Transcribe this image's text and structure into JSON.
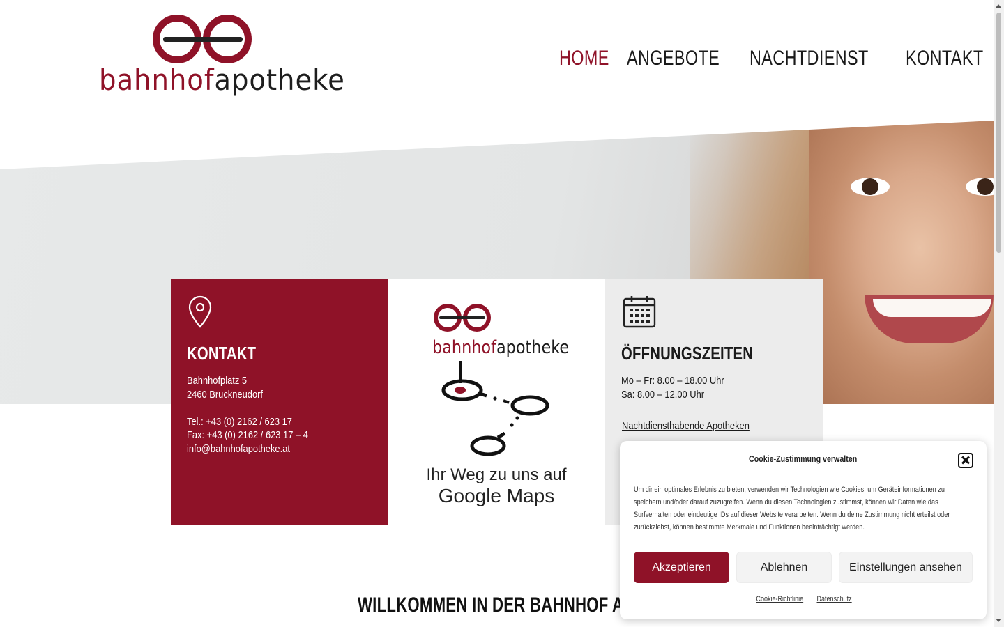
{
  "brand": {
    "logo_part1": "bahnhof",
    "logo_part2": "apotheke",
    "color_primary": "#8f1228",
    "color_dark": "#1e1e1e"
  },
  "nav": [
    {
      "label": "HOME",
      "active": true
    },
    {
      "label": "ANGEBOTE",
      "active": false
    },
    {
      "label": "NACHTDIENST",
      "active": false
    },
    {
      "label": "KONTAKT",
      "active": false
    }
  ],
  "contact_box": {
    "icon": "location-pin-icon",
    "title": "KONTAKT",
    "lines": [
      "Bahnhofplatz 5",
      "2460 Bruckneudorf",
      "",
      "Tel.: +43 (0) 2162 / 623 17",
      "Fax: +43 (0) 2162 / 623 17 – 4",
      "info@bahnhofapotheke.at"
    ]
  },
  "map_box": {
    "logo_part1": "bahnhof",
    "logo_part2": "apotheke",
    "caption_line1": "Ihr Weg zu uns auf",
    "caption_line2": "Google Maps"
  },
  "hours_box": {
    "icon": "calendar-icon",
    "title": "ÖFFNUNGSZEITEN",
    "lines": [
      "Mo – Fr: 8.00 – 18.00 Uhr",
      "Sa: 8.00 – 12.00 Uhr"
    ],
    "link": "Nachtdiensthabende Apotheken"
  },
  "welcome_heading": "WILLKOMMEN IN DER BAHNHOF APOTHEK",
  "cookie": {
    "title": "Cookie-Zustimmung verwalten",
    "text": "Um dir ein optimales Erlebnis zu bieten, verwenden wir Technologien wie Cookies, um Geräteinformationen zu speichern und/oder darauf zuzugreifen. Wenn du diesen Technologien zustimmst, können wir Daten wie das Surfverhalten oder eindeutige IDs auf dieser Website verarbeiten. Wenn du deine Zustimmung nicht erteilst oder zurückziehst, können bestimmte Merkmale und Funktionen beeinträchtigt werden.",
    "accept": "Akzeptieren",
    "deny": "Ablehnen",
    "settings": "Einstellungen ansehen",
    "link1": "Cookie-Richtlinie",
    "link2": "Datenschutz"
  }
}
